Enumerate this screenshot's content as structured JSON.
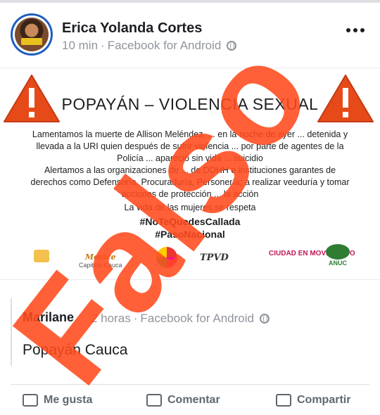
{
  "post": {
    "author": "Erica Yolanda Cortes",
    "time": "10 min",
    "source": "Facebook for Android",
    "privacy_icon": "globe-icon",
    "menu_icon": "more-options-icon"
  },
  "flyer": {
    "title": "POPAYÁN – VIOLENCIA SEXUAL",
    "paragraph1": "Lamentamos la muerte de Allison Meléndez, ... en la noche de ayer ... detenida y llevada a la URI quien después de sufrir violencia ... por parte de agentes de la Policía ... apareció sin vida ... suicidio",
    "paragraph2": "Alertamos a las organizaciones de ... de DDHH e instituciones garantes de derechos como Defensoría, Procuraduría, Personería; a realizar veeduría y tomar acciones de protección ... la acción",
    "closing": "La vida de las mujeres se respeta",
    "hashtag1": "#NoTeQuedesCallada",
    "hashtag2": "#PasoNacional",
    "logos": [
      "Movice",
      "Capitulo Cauca",
      "TPVD",
      "CIUDAD EN MOVIMIENTO",
      "ANUC"
    ],
    "accent_color": "#e8421e"
  },
  "shared": {
    "author": "Marilane",
    "time": "2 horas",
    "source": "Facebook for Android",
    "text": "Popayán Cauca"
  },
  "actions": {
    "like": "Me gusta",
    "comment": "Comentar",
    "share": "Compartir"
  },
  "stamp": {
    "text": "Falso",
    "color": "#ff4a1c"
  }
}
